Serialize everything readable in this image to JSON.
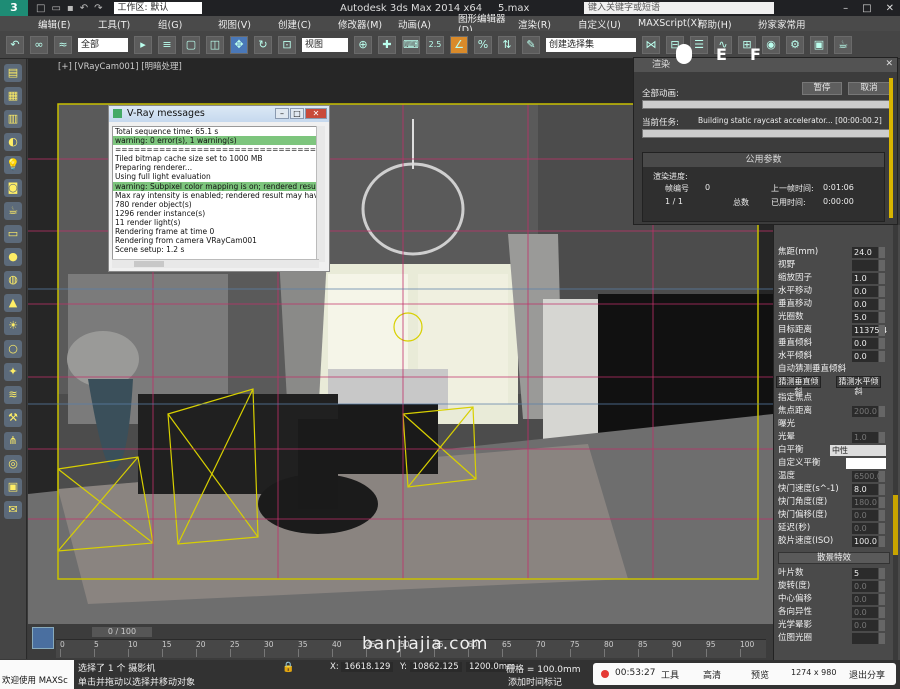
{
  "app": {
    "workspace": "工作区: 默认",
    "title": "Autodesk 3ds Max  2014 x64",
    "title_file": "5.max",
    "search_placeholder": "键入关键字或短语",
    "logo": "3"
  },
  "menubar": [
    "编辑(E)",
    "工具(T)",
    "组(G)",
    "视图(V)",
    "创建(C)",
    "修改器(M)",
    "动画(A)",
    "图形编辑器(D)",
    "渲染(R)",
    "自定义(U)",
    "MAXScript(X)",
    "帮助(H)",
    "扮家家常用"
  ],
  "toolbar": {
    "selection_filter": "全部",
    "ref_coord": "视图",
    "named_set": "创建选择集",
    "snap_label": "2.5"
  },
  "viewport": {
    "label": "[+] [VRayCam001] [明暗处理]"
  },
  "vray_messages": {
    "title": "V-Ray messages",
    "lines": [
      {
        "text": "Total sequence time: 65.1 s",
        "warn": false
      },
      {
        "text": "warning: 0 error(s), 1 warning(s)",
        "warn": true
      },
      {
        "text": "================================",
        "warn": false
      },
      {
        "text": "Tiled bitmap cache size set to 1000 MB",
        "warn": false
      },
      {
        "text": "Preparing renderer...",
        "warn": false
      },
      {
        "text": "Using full light evaluation",
        "warn": false
      },
      {
        "text": "warning: Subpixel color mapping is on; rendered result may h",
        "warn": true
      },
      {
        "text": "Max ray intensity is enabled; rendered result may have incom",
        "warn": false
      },
      {
        "text": "780 render object(s)",
        "warn": false
      },
      {
        "text": "1296 render instance(s)",
        "warn": false
      },
      {
        "text": "11 render light(s)",
        "warn": false
      },
      {
        "text": "Rendering frame at time 0",
        "warn": false
      },
      {
        "text": "Rendering from camera VRayCam001",
        "warn": false
      },
      {
        "text": "Scene setup: 1.2 s",
        "warn": false
      }
    ]
  },
  "render_dialog": {
    "title": "渲染",
    "overall_label": "全部动画:",
    "current_label": "当前任务:",
    "current_task": "Building static raycast accelerator... [00:00:00.2]",
    "pause": "暂停",
    "cancel": "取消",
    "group_title": "公用参数",
    "progress_label": "渲染进度:",
    "frame_label": "帧编号",
    "frame_value": "0",
    "count": "1 / 1",
    "total_label": "总数",
    "last_frame_label": "上一帧时间:",
    "last_frame_time": "0:01:06",
    "elapsed_label": "已用时间:",
    "elapsed_time": "0:00:00"
  },
  "overlay_letters": {
    "e": "E",
    "f": "F"
  },
  "command_panel": {
    "params": [
      {
        "label": "焦距(mm)",
        "value": "24.0",
        "dim": false
      },
      {
        "label": "视野",
        "value": "",
        "dim": true
      },
      {
        "label": "缩放因子",
        "value": "1.0",
        "dim": false
      },
      {
        "label": "水平移动",
        "value": "0.0",
        "dim": false
      },
      {
        "label": "垂直移动",
        "value": "0.0",
        "dim": false
      },
      {
        "label": "光圈数",
        "value": "5.0",
        "dim": false
      },
      {
        "label": "目标距离",
        "value": "11375.4",
        "dim": false
      },
      {
        "label": "垂直倾斜",
        "value": "0.0",
        "dim": false
      },
      {
        "label": "水平倾斜",
        "value": "0.0",
        "dim": false
      }
    ],
    "auto_vertical": "自动猜测垂直倾斜",
    "guess_vertical": "猜测垂直倾斜",
    "guess_horizontal": "猜测水平倾斜",
    "specify_focus": "指定焦点",
    "focus_distance_label": "焦点距离",
    "focus_distance": "200.0",
    "exposure": "曝光",
    "vignette": "光晕",
    "vignette_value": "1.0",
    "white_balance_label": "白平衡",
    "white_balance": "中性",
    "custom_balance": "自定义平衡",
    "temperature_label": "温度",
    "temperature": "6500.0",
    "shutter": [
      {
        "label": "快门速度(s^-1)",
        "value": "8.0"
      },
      {
        "label": "快门角度(度)",
        "value": "180.0"
      },
      {
        "label": "快门偏移(度)",
        "value": "0.0"
      },
      {
        "label": "延迟(秒)",
        "value": "0.0"
      },
      {
        "label": "胶片速度(ISO)",
        "value": "100.0"
      }
    ],
    "bokeh_title": "散景特效",
    "bokeh": [
      {
        "label": "叶片数",
        "value": "5"
      },
      {
        "label": "旋转(度)",
        "value": "0.0"
      },
      {
        "label": "中心偏移",
        "value": "0.0"
      },
      {
        "label": "各向异性",
        "value": "0.0"
      },
      {
        "label": "光学晕影",
        "value": "0.0"
      },
      {
        "label": "位图光圈",
        "value": ""
      }
    ]
  },
  "timeline": {
    "frame_counter": "0 / 100",
    "ticks": [
      "0",
      "5",
      "10",
      "15",
      "20",
      "25",
      "30",
      "35",
      "40",
      "45",
      "50",
      "55",
      "60",
      "65",
      "70",
      "75",
      "80",
      "85",
      "90",
      "95",
      "100"
    ]
  },
  "status": {
    "welcome": "欢迎使用 MAXSc",
    "selected": "选择了 1 个 摄影机",
    "prompt": "单击并拖动以选择并移动对象",
    "x_value": "16618.129",
    "y_value": "10862.125",
    "z_value": "1200.0mm",
    "grid": "栅格 = 100.0mm",
    "add_time_tag": "添加时间标记",
    "watermark": "banjiajia.com"
  },
  "recorder": {
    "time": "00:53:27",
    "tools": "工具",
    "quality": "高清",
    "preview": "预览",
    "resolution": "1274 x 980",
    "exit_share": "退出分享"
  }
}
